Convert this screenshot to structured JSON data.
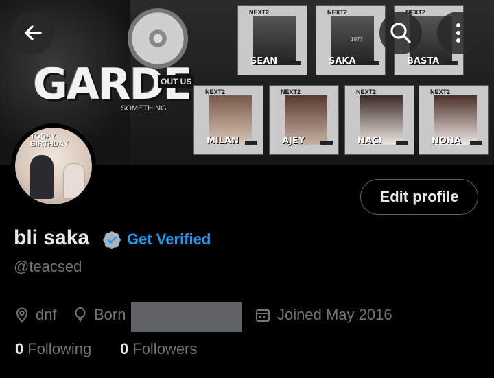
{
  "banner": {
    "title_text": "GARDE",
    "sticker_text": "OUT US",
    "sub_text": "SOMETHING",
    "card_tag": "NEXT2",
    "cards_top": [
      "SEAN",
      "SAKA",
      "BASTA"
    ],
    "cards_bottom": [
      "MILAN",
      "AJEY",
      "NACI",
      "NONA"
    ],
    "card_extra": "1977"
  },
  "avatar": {
    "caption_line1": "TODAY",
    "caption_line2": "BIRTHDAY"
  },
  "actions": {
    "edit_profile_label": "Edit profile"
  },
  "profile": {
    "display_name": "bli saka",
    "get_verified_label": "Get Verified",
    "handle": "@teacsed",
    "location": "dnf",
    "born_label": "Born",
    "joined": "Joined May 2016"
  },
  "stats": {
    "following_count": "0",
    "following_label": "Following",
    "followers_count": "0",
    "followers_label": "Followers"
  },
  "colors": {
    "accent": "#1d9bf0",
    "muted": "#71767b",
    "text": "#e7e9ea",
    "background": "#000000"
  },
  "icons": [
    "back-arrow-icon",
    "search-icon",
    "more-vertical-icon",
    "verified-badge-icon",
    "location-pin-icon",
    "birthday-balloon-icon",
    "calendar-icon"
  ]
}
